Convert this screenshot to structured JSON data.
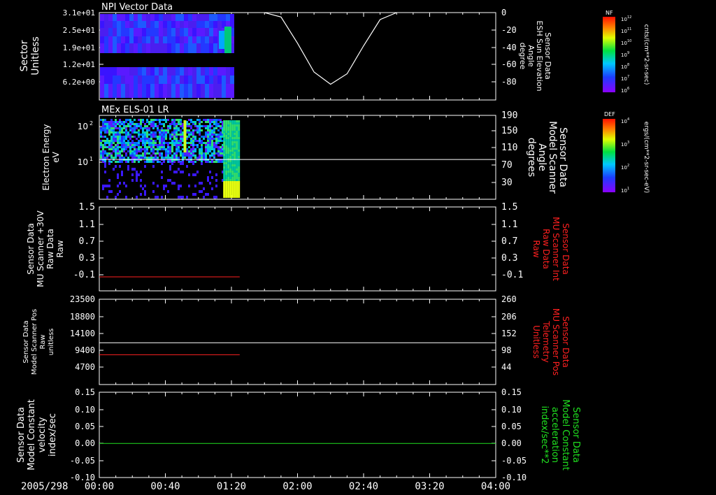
{
  "date_label": "2005/298",
  "time_ticks": [
    "00:00",
    "00:40",
    "01:20",
    "02:00",
    "02:40",
    "03:20",
    "04:00"
  ],
  "colors": {
    "red": "#ff2020",
    "green": "#20e020",
    "white": "#ffffff"
  },
  "panels": [
    {
      "id": "npi",
      "title": "NPI Vector Data",
      "left_label": [
        "Sector",
        "Unitless"
      ],
      "left_ticks": [
        "3.1e+01",
        "2.5e+01",
        "1.9e+01",
        "1.2e+01",
        "6.2e+00"
      ],
      "right_label": [
        "Sensor Data",
        "ESH Sun Elevation",
        "Angle",
        "degree"
      ],
      "right_ticks": [
        "0",
        "-20",
        "-40",
        "-60",
        "-80"
      ],
      "colorbar": {
        "title": "NF",
        "unit": "cnts/(cm**2-sr-sec)",
        "ticks": [
          "10^12",
          "10^11",
          "10^10",
          "10^9",
          "10^8",
          "10^7",
          "10^6"
        ]
      }
    },
    {
      "id": "els",
      "title": "MEx ELS-01 LR",
      "left_label": [
        "Electron Energy",
        "eV"
      ],
      "left_ticks": [
        "10^2",
        "10^1"
      ],
      "right_label": [
        "Sensor Data",
        "Model Scanner",
        "Angle",
        "degrees"
      ],
      "right_ticks": [
        "190",
        "150",
        "110",
        "70",
        "30"
      ],
      "colorbar": {
        "title": "DEF",
        "unit": "ergs/(cm**2-sr-sec-eV)",
        "ticks": [
          "10^4",
          "10^3",
          "10^2",
          "10^1"
        ]
      }
    },
    {
      "id": "mu_raw",
      "left_label": [
        "Sensor Data",
        "MU Scanner +30V",
        "Raw Data",
        "Raw"
      ],
      "left_ticks": [
        "1.5",
        "1.1",
        "0.7",
        "0.3",
        "-0.1"
      ],
      "right_label": [
        "Sensor Data",
        "MU Scanner Int",
        "Raw Data",
        "Raw"
      ],
      "right_ticks": [
        "1.5",
        "1.1",
        "0.7",
        "0.3",
        "-0.1"
      ]
    },
    {
      "id": "scanner_pos",
      "left_label": [
        "Sensor Data",
        "Model Scanner Pos",
        "Raw",
        "unitless"
      ],
      "left_ticks": [
        "23500",
        "18800",
        "14100",
        "9400",
        "4700"
      ],
      "right_label": [
        "Sensor Data",
        "MU Scanner Pos",
        "Telemetry",
        "Unitless"
      ],
      "right_ticks": [
        "260",
        "206",
        "152",
        "98",
        "44"
      ]
    },
    {
      "id": "velocity",
      "left_label": [
        "Sensor Data",
        "Model Constant",
        "velocity",
        "index/sec"
      ],
      "left_ticks": [
        "0.15",
        "0.10",
        "0.05",
        "0.00",
        "-0.05",
        "-0.10"
      ],
      "right_label": [
        "Sensor Data",
        "Model Constant",
        "acceleration",
        "index/sec**2"
      ],
      "right_ticks": [
        "0.15",
        "0.10",
        "0.05",
        "0.00",
        "-0.05",
        "-0.10"
      ]
    }
  ],
  "chart_data": [
    {
      "type": "heatmap",
      "title": "NPI Vector Data",
      "x_range": [
        "00:00",
        "04:00"
      ],
      "data_extent": [
        "00:00",
        "01:20"
      ],
      "ylabel": "Sector Unitless",
      "ylim": [
        0,
        31
      ],
      "overlay_series": {
        "name": "ESH Sun Elevation Angle",
        "ylim": [
          -100,
          0
        ],
        "x": [
          "01:40",
          "01:50",
          "02:00",
          "02:10",
          "02:20",
          "02:30",
          "02:40",
          "02:50",
          "03:00"
        ],
        "values": [
          0,
          -5,
          -35,
          -68,
          -82,
          -70,
          -38,
          -8,
          0
        ]
      }
    },
    {
      "type": "heatmap",
      "title": "MEx ELS-01 LR",
      "x_range": [
        "00:00",
        "04:00"
      ],
      "data_extent": [
        "00:00",
        "01:25"
      ],
      "ylabel": "Electron Energy eV",
      "yscale": "log",
      "overlay_series": {
        "name": "Model Scanner Angle",
        "ylim": [
          0,
          190
        ],
        "x": [
          "00:00",
          "04:00"
        ],
        "values": [
          90,
          90
        ]
      }
    },
    {
      "type": "line",
      "x_range": [
        "00:00",
        "04:00"
      ],
      "ylim": [
        -0.3,
        1.5
      ],
      "series": [
        {
          "name": "MU Scanner Int Raw Data",
          "color": "#ff2020",
          "x": [
            "00:00",
            "01:25"
          ],
          "values": [
            0.0,
            0.0
          ]
        }
      ]
    },
    {
      "type": "line",
      "x_range": [
        "00:00",
        "04:00"
      ],
      "ylim": [
        0,
        23500
      ],
      "series": [
        {
          "name": "Model Scanner Pos Raw",
          "color": "#ffffff",
          "x": [
            "00:00",
            "04:00"
          ],
          "values": [
            11500,
            11500
          ]
        },
        {
          "name": "MU Scanner Pos Telemetry",
          "color": "#ff2020",
          "x": [
            "00:00",
            "01:25"
          ],
          "values": [
            8200,
            8200
          ]
        }
      ]
    },
    {
      "type": "line",
      "x_range": [
        "00:00",
        "04:00"
      ],
      "ylim": [
        -0.1,
        0.15
      ],
      "series": [
        {
          "name": "Model Constant velocity",
          "color": "#20e020",
          "x": [
            "00:00",
            "04:00"
          ],
          "values": [
            0.0,
            0.0
          ]
        }
      ]
    }
  ]
}
